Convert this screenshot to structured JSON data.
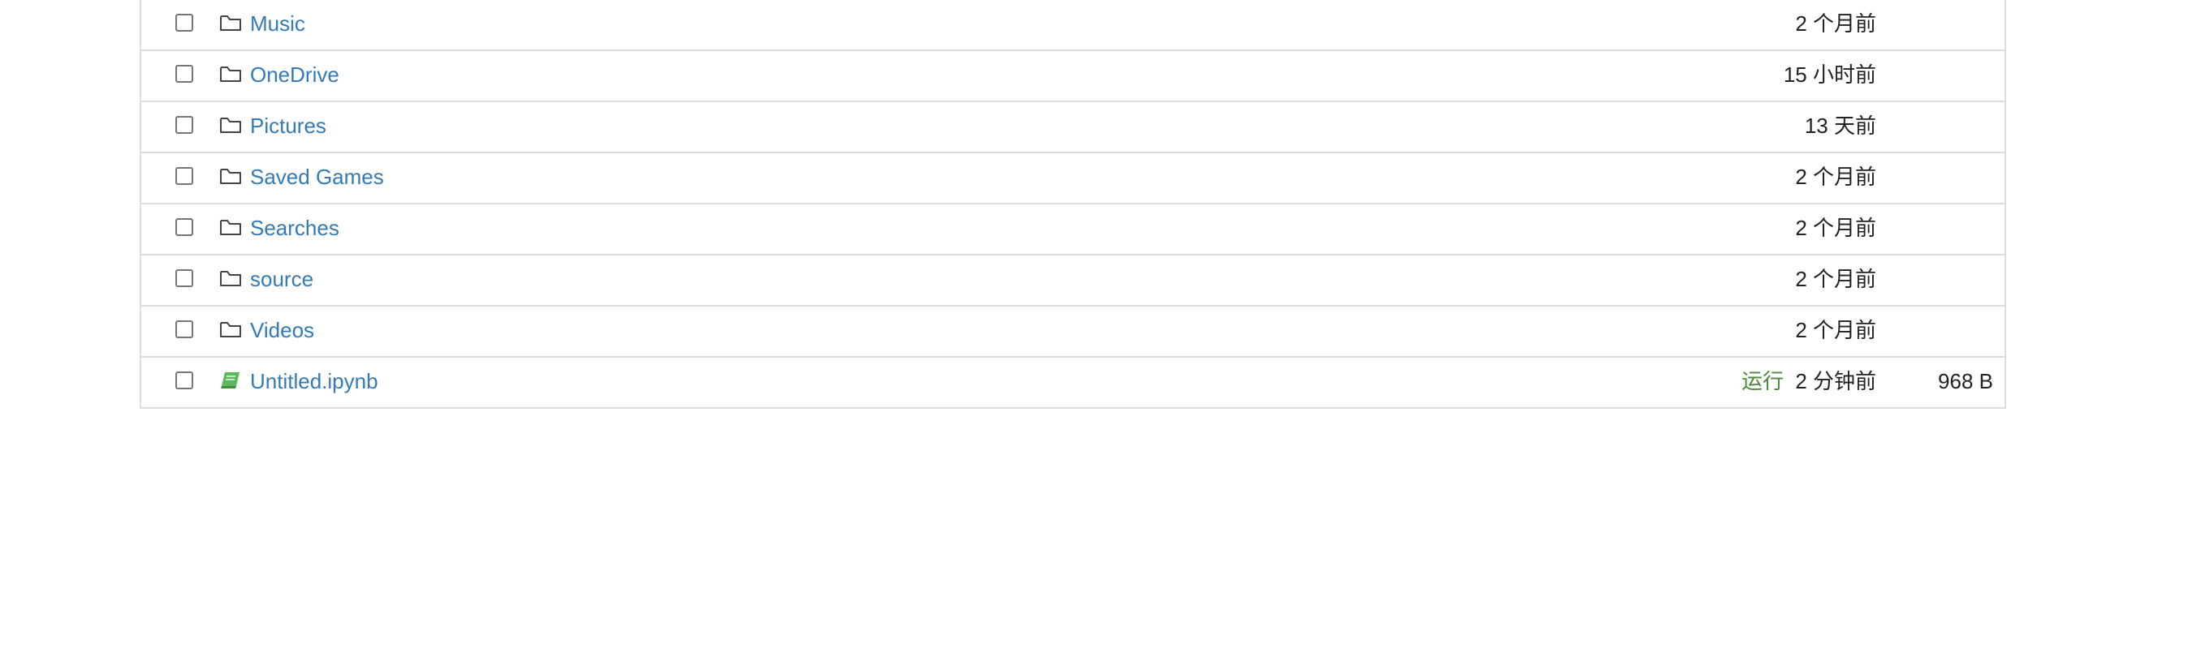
{
  "files": [
    {
      "name": "Music",
      "type": "folder",
      "icon": "folder-icon",
      "status": "",
      "modified": "2 个月前",
      "size": ""
    },
    {
      "name": "OneDrive",
      "type": "folder",
      "icon": "folder-icon",
      "status": "",
      "modified": "15 小时前",
      "size": ""
    },
    {
      "name": "Pictures",
      "type": "folder",
      "icon": "folder-icon",
      "status": "",
      "modified": "13 天前",
      "size": ""
    },
    {
      "name": "Saved Games",
      "type": "folder",
      "icon": "folder-icon",
      "status": "",
      "modified": "2 个月前",
      "size": ""
    },
    {
      "name": "Searches",
      "type": "folder",
      "icon": "folder-icon",
      "status": "",
      "modified": "2 个月前",
      "size": ""
    },
    {
      "name": "source",
      "type": "folder",
      "icon": "folder-icon",
      "status": "",
      "modified": "2 个月前",
      "size": ""
    },
    {
      "name": "Videos",
      "type": "folder",
      "icon": "folder-icon",
      "status": "",
      "modified": "2 个月前",
      "size": ""
    },
    {
      "name": "Untitled.ipynb",
      "type": "notebook",
      "icon": "notebook-icon",
      "status": "运行",
      "modified": "2 分钟前",
      "size": "968 B"
    }
  ],
  "colors": {
    "link": "#337ab7",
    "running": "#4a8a3a",
    "notebook_icon": "#5cb85c",
    "border": "#dddddd"
  }
}
